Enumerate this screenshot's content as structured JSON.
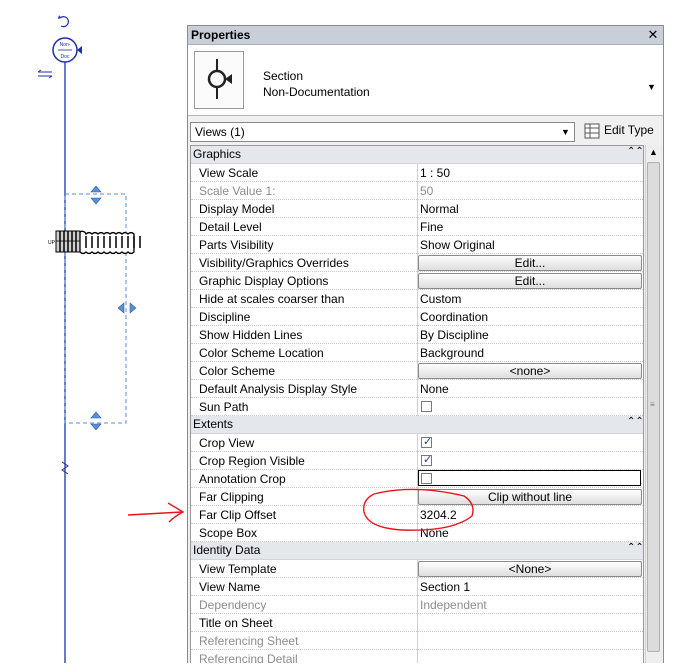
{
  "canvas": {
    "section_head_text": "Non-\n1 —\nDoc",
    "up_label": "UP"
  },
  "panel": {
    "title": "Properties",
    "close_glyph": "✕",
    "type_name": "Section",
    "type_subname": "Non-Documentation",
    "type_dropdown_glyph": "▼",
    "views_selector": "Views (1)",
    "views_dropdown_glyph": "▼",
    "edit_type_label": "Edit Type",
    "collapse_glyph": "⌃⌃",
    "scroll_up_glyph": "▲",
    "scroll_grip_glyph": "≡"
  },
  "groups": [
    {
      "label": "Graphics",
      "rows": [
        {
          "name": "View Scale",
          "value": "1 : 50"
        },
        {
          "name": "Scale Value    1:",
          "value": "50",
          "disabled": true
        },
        {
          "name": "Display Model",
          "value": "Normal"
        },
        {
          "name": "Detail Level",
          "value": "Fine"
        },
        {
          "name": "Parts Visibility",
          "value": "Show Original"
        },
        {
          "name": "Visibility/Graphics Overrides",
          "button": "Edit..."
        },
        {
          "name": "Graphic Display Options",
          "button": "Edit..."
        },
        {
          "name": "Hide at scales coarser than",
          "value": "Custom"
        },
        {
          "name": "Discipline",
          "value": "Coordination"
        },
        {
          "name": "Show Hidden Lines",
          "value": "By Discipline"
        },
        {
          "name": "Color Scheme Location",
          "value": "Background"
        },
        {
          "name": "Color Scheme",
          "button": "<none>"
        },
        {
          "name": "Default Analysis Display Style",
          "value": "None"
        },
        {
          "name": "Sun Path",
          "checkbox": false
        }
      ]
    },
    {
      "label": "Extents",
      "rows": [
        {
          "name": "Crop View",
          "checkbox": true
        },
        {
          "name": "Crop Region Visible",
          "checkbox": true
        },
        {
          "name": "Annotation Crop",
          "checkbox": false,
          "focused": true
        },
        {
          "name": "Far Clipping",
          "button": "Clip without line"
        },
        {
          "name": "Far Clip Offset",
          "value": "3204.2"
        },
        {
          "name": "Scope Box",
          "value": "None"
        }
      ]
    },
    {
      "label": "Identity Data",
      "rows": [
        {
          "name": "View Template",
          "button": "<None>"
        },
        {
          "name": "View Name",
          "value": "Section 1"
        },
        {
          "name": "Dependency",
          "value": "Independent",
          "disabled": true
        },
        {
          "name": "Title on Sheet",
          "value": ""
        },
        {
          "name": "Referencing Sheet",
          "value": "",
          "disabled": true
        },
        {
          "name": "Referencing Detail",
          "value": "",
          "disabled": true
        }
      ]
    }
  ],
  "colors": {
    "annotation_red": "#e8141b",
    "section_line_blue": "#1f2fa8",
    "crop_dashed_blue": "#5b8fd6"
  }
}
